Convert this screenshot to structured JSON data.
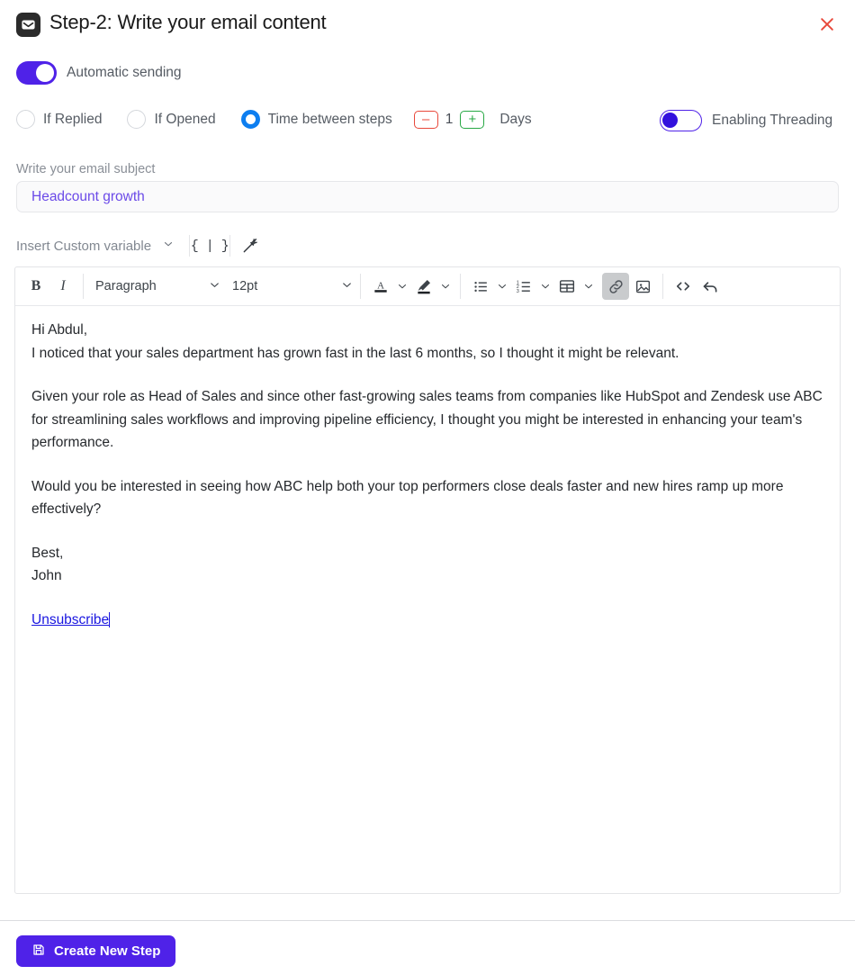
{
  "header": {
    "icon": "envelope-icon",
    "title": "Step-2:  Write your email content",
    "close_icon": "close-icon",
    "close_color": "#e8483a"
  },
  "automatic_sending": {
    "label": "Automatic sending",
    "state": "on",
    "accent": "#4f22e8"
  },
  "conditions": {
    "options": [
      {
        "label": "If Replied",
        "selected": false
      },
      {
        "label": "If Opened",
        "selected": false
      },
      {
        "label": "Time between steps",
        "selected": true
      }
    ],
    "selected_accent": "#0d7ef0",
    "stepper": {
      "minus_label": "–",
      "minus_color": "#e8483a",
      "value": "1",
      "plus_label": "+",
      "plus_color": "#27a844",
      "unit_label": "Days"
    }
  },
  "threading": {
    "label": "Enabling Threading",
    "state": "off",
    "accent": "#4f22e8"
  },
  "subject": {
    "label": "Write your email subject",
    "value": "Headcount growth",
    "placeholder": "Write your email subject",
    "text_color": "#6b4ae8"
  },
  "variable_bar": {
    "select_label": "Insert Custom variable",
    "chevron_icon": "chevron-down-icon",
    "brace_label": "{ | }",
    "brace_icon": "curly-braces-icon",
    "wand_icon": "magic-wand-icon"
  },
  "toolbar": {
    "bold_label": "B",
    "italic_label": "I",
    "block_format": "Paragraph",
    "font_size": "12pt",
    "text_color_icon": "text-color-icon",
    "highlight_icon": "highlight-color-icon",
    "bullet_list_icon": "bullet-list-icon",
    "numbered_list_icon": "numbered-list-icon",
    "table_icon": "table-icon",
    "link_icon": "link-icon",
    "image_icon": "image-icon",
    "code_icon": "source-code-icon",
    "undo_icon": "undo-icon",
    "link_active": true
  },
  "email_body": {
    "greeting": "Hi Abdul,",
    "line2": "I noticed that your sales department has grown fast in the last 6 months, so I thought it might be relevant.",
    "paragraph2": "Given your role as Head of Sales and since other fast-growing sales teams from companies like HubSpot and Zendesk use ABC for streamlining sales workflows and improving pipeline efficiency, I thought you might be interested in enhancing your team's performance.",
    "paragraph3": "Would you be interested in seeing how ABC help both your top performers close deals faster and new hires ramp up more effectively?",
    "signoff": "Best,",
    "sender": "John",
    "unsubscribe": "Unsubscribe"
  },
  "footer": {
    "create_label": "Create New Step",
    "save_icon": "save-icon",
    "button_color": "#4f22e8"
  }
}
